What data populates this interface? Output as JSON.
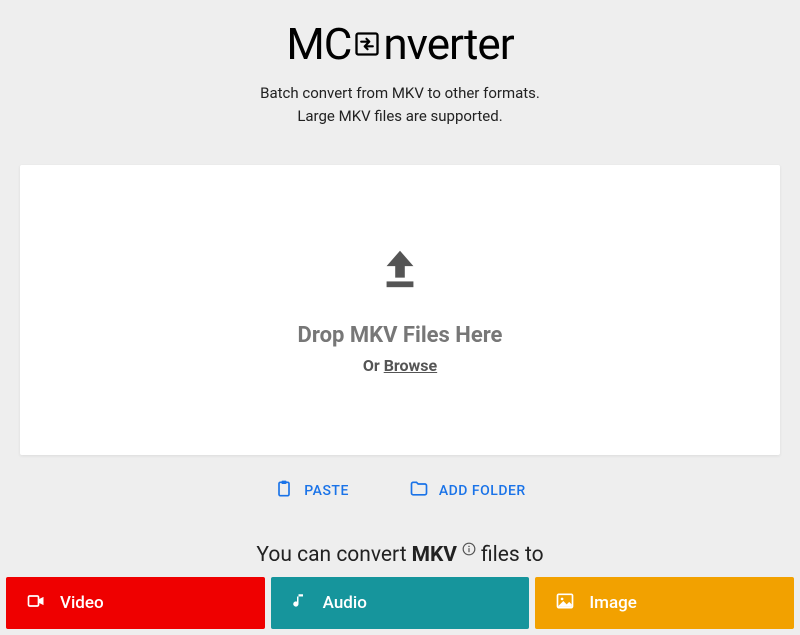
{
  "logo": {
    "pre": "MC",
    "post": "nverter"
  },
  "subtitle_line1": "Batch convert from MKV to other formats.",
  "subtitle_line2": "Large MKV files are supported.",
  "dropzone": {
    "heading": "Drop MKV Files Here",
    "or": "Or ",
    "browse": "Browse"
  },
  "actions": {
    "paste": "PASTE",
    "add_folder": "ADD FOLDER"
  },
  "convert": {
    "pre": "You can convert",
    "format": "MKV",
    "post": "files to"
  },
  "formats": {
    "video": "Video",
    "audio": "Audio",
    "image": "Image"
  }
}
